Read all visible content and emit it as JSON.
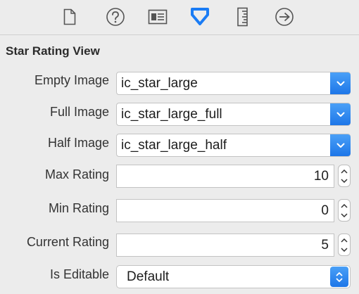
{
  "toolbar": {
    "icons": [
      {
        "name": "file-icon",
        "selected": false
      },
      {
        "name": "help-icon",
        "selected": false
      },
      {
        "name": "identity-icon",
        "selected": false
      },
      {
        "name": "attributes-icon",
        "selected": true
      },
      {
        "name": "size-icon",
        "selected": false
      },
      {
        "name": "connections-icon",
        "selected": false
      }
    ],
    "accent_color": "#1a7cf5"
  },
  "section": {
    "title": "Star Rating View"
  },
  "fields": {
    "empty_image": {
      "label": "Empty Image",
      "value": "ic_star_large"
    },
    "full_image": {
      "label": "Full Image",
      "value": "ic_star_large_full"
    },
    "half_image": {
      "label": "Half Image",
      "value": "ic_star_large_half"
    },
    "max_rating": {
      "label": "Max Rating",
      "value": "10"
    },
    "min_rating": {
      "label": "Min Rating",
      "value": "0"
    },
    "current_rating": {
      "label": "Current Rating",
      "value": "5"
    },
    "is_editable": {
      "label": "Is Editable",
      "value": "Default"
    }
  }
}
